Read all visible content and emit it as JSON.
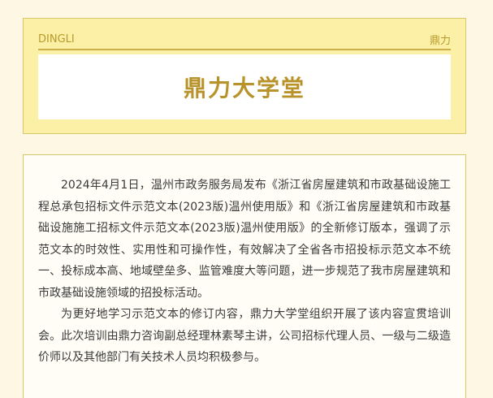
{
  "header": {
    "brand_left": "DINGLI",
    "brand_right": "鼎力",
    "title": "鼎力大学堂"
  },
  "article": {
    "paragraphs": [
      "2024年4月1日，温州市政务服务局发布《浙江省房屋建筑和市政基础设施工程总承包招标文件示范文本(2023版)温州使用版》和《浙江省房屋建筑和市政基础设施施工招标文件示范文本(2023版)温州使用版》的全新修订版本，强调了示范文本的时效性、实用性和可操作性，有效解决了全省各市招投标示范文本不统一、投标成本高、地域壁垒多、监管难度大等问题，进一步规范了我市房屋建筑和市政基础设施领域的招投标活动。",
      "为更好地学习示范文本的修订内容，鼎力大学堂组织开展了该内容宣贯培训会。此次培训由鼎力咨询副总经理林素琴主讲，公司招标代理人员、一级与二级造价师以及其他部门有关技术人员均积极参与。"
    ]
  },
  "colors": {
    "background": "#fdf7e3",
    "header_fill": "#fbf0a6",
    "accent_gold": "#b8922a",
    "border": "#d9c66a"
  }
}
